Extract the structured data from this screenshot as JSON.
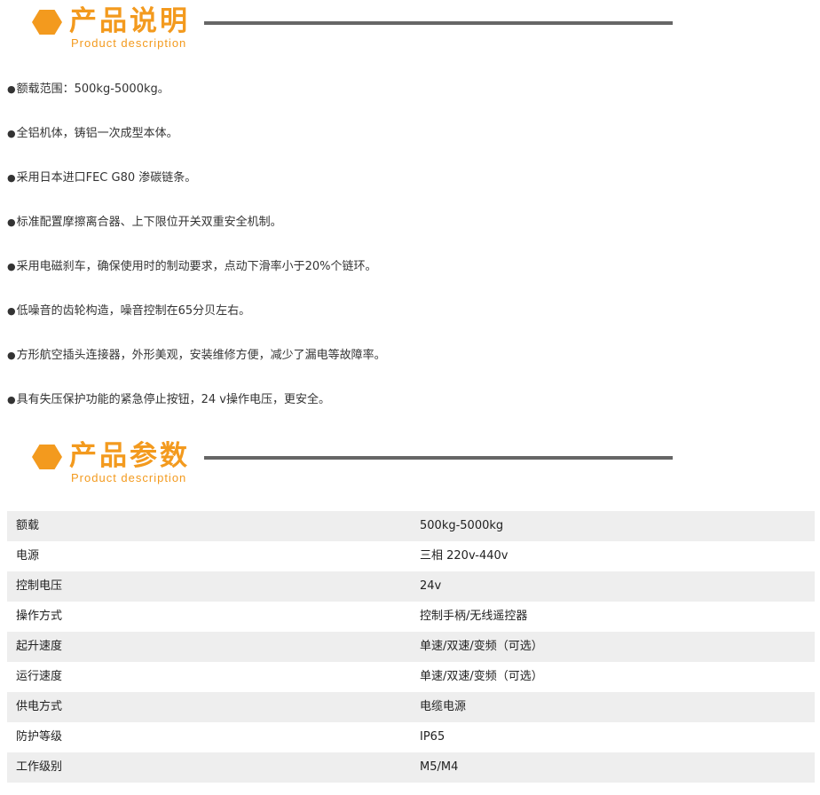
{
  "description_section": {
    "title_zh": "产品说明",
    "title_en": "Product description",
    "bullet": "●",
    "items": [
      "额载范围：500kg-5000kg。",
      "全铝机体，铸铝一次成型本体。",
      "采用日本进口FEC G80 渗碳链条。",
      "标准配置摩擦离合器、上下限位开关双重安全机制。",
      "采用电磁刹车，确保使用时的制动要求，点动下滑率小于20%个链环。",
      "低噪音的齿轮构造，噪音控制在65分贝左右。",
      "方形航空插头连接器，外形美观，安装维修方便，减少了漏电等故障率。",
      "具有失压保护功能的紧急停止按钮，24 v操作电压，更安全。"
    ]
  },
  "params_section": {
    "title_zh": "产品参数",
    "title_en": "Product description",
    "rows": [
      {
        "label": "额载",
        "value": "500kg-5000kg"
      },
      {
        "label": "电源",
        "value": "三相 220v-440v"
      },
      {
        "label": "控制电压",
        "value": "24v"
      },
      {
        "label": "操作方式",
        "value": "控制手柄/无线遥控器"
      },
      {
        "label": "起升速度",
        "value": "单速/双速/变频（可选）"
      },
      {
        "label": "运行速度",
        "value": "单速/双速/变频（可选）"
      },
      {
        "label": "供电方式",
        "value": "电缆电源"
      },
      {
        "label": "防护等级",
        "value": "IP65"
      },
      {
        "label": "工作级别",
        "value": "M5/M4"
      }
    ]
  },
  "colors": {
    "accent": "#f39a1e",
    "rule": "#666666",
    "row_alt": "#eeeeee"
  }
}
